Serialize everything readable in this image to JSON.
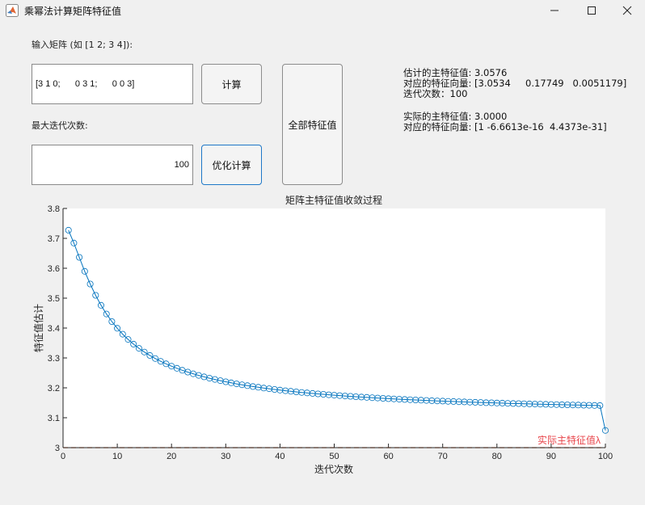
{
  "window": {
    "title": "乘幂法计算矩阵特征值",
    "icon": "matlab-icon"
  },
  "inputs": {
    "matrix_label": "输入矩阵 (如 [1 2; 3 4]):",
    "matrix_value": "[3 1 0;      0 3 1;      0 0 3]",
    "maxiter_label": "最大迭代次数:",
    "maxiter_value": "100"
  },
  "buttons": {
    "compute": "计算",
    "optimized": "优化计算",
    "all_eigen": "全部特征值"
  },
  "results": {
    "est_value": "估计的主特征值: 3.0576",
    "est_vector": "对应的特征向量: [3.0534     0.17749   0.0051179]",
    "iterations": "迭代次数：100",
    "true_value": "实际的主特征值: 3.0000",
    "true_vector": "对应的特征向量: [1 -6.6613e-16  4.4373e-31]"
  },
  "chart_data": {
    "type": "line",
    "title": "矩阵主特征值收敛过程",
    "xlabel": "迭代次数",
    "ylabel": "特征值估计",
    "xlim": [
      0,
      100
    ],
    "ylim": [
      3,
      3.8
    ],
    "xticks": [
      0,
      10,
      20,
      30,
      40,
      50,
      60,
      70,
      80,
      90,
      100
    ],
    "yticks": [
      3,
      3.1,
      3.2,
      3.3,
      3.4,
      3.5,
      3.6,
      3.7,
      3.8
    ],
    "grid": false,
    "series": [
      {
        "color": "#0072bd",
        "marker": "circle",
        "x": [
          1,
          2,
          3,
          4,
          5,
          6,
          7,
          8,
          9,
          10,
          11,
          12,
          13,
          14,
          15,
          16,
          17,
          18,
          19,
          20,
          21,
          22,
          23,
          24,
          25,
          26,
          27,
          28,
          29,
          30,
          31,
          32,
          33,
          34,
          35,
          36,
          37,
          38,
          39,
          40,
          41,
          42,
          43,
          44,
          45,
          46,
          47,
          48,
          49,
          50,
          51,
          52,
          53,
          54,
          55,
          56,
          57,
          58,
          59,
          60,
          61,
          62,
          63,
          64,
          65,
          66,
          67,
          68,
          69,
          70,
          71,
          72,
          73,
          74,
          75,
          76,
          77,
          78,
          79,
          80,
          81,
          82,
          83,
          84,
          85,
          86,
          87,
          88,
          89,
          90,
          91,
          92,
          93,
          94,
          95,
          96,
          97,
          98,
          99,
          100
        ],
        "y": [
          3.7273,
          3.6842,
          3.6364,
          3.5897,
          3.5472,
          3.5094,
          3.4762,
          3.4471,
          3.4216,
          3.3992,
          3.3794,
          3.3618,
          3.3462,
          3.3322,
          3.3196,
          3.3083,
          3.298,
          3.2887,
          3.2802,
          3.2724,
          3.2653,
          3.2587,
          3.2526,
          3.2469,
          3.2417,
          3.2368,
          3.2322,
          3.228,
          3.224,
          3.2202,
          3.2167,
          3.2133,
          3.2102,
          3.2072,
          3.2044,
          3.2018,
          3.1993,
          3.1969,
          3.1946,
          3.1924,
          3.1904,
          3.1884,
          3.1865,
          3.1847,
          3.183,
          3.1814,
          3.1798,
          3.1783,
          3.1768,
          3.1754,
          3.1741,
          3.1728,
          3.1715,
          3.1703,
          3.1691,
          3.168,
          3.1669,
          3.1659,
          3.1649,
          3.1639,
          3.1629,
          3.162,
          3.1611,
          3.1602,
          3.1594,
          3.1586,
          3.1578,
          3.157,
          3.1563,
          3.1556,
          3.1549,
          3.1542,
          3.1535,
          3.1529,
          3.1522,
          3.1516,
          3.151,
          3.1504,
          3.1499,
          3.1493,
          3.1488,
          3.1482,
          3.1477,
          3.1472,
          3.1467,
          3.1462,
          3.1458,
          3.1453,
          3.1449,
          3.1444,
          3.144,
          3.1436,
          3.1432,
          3.1428,
          3.1424,
          3.142,
          3.1416,
          3.1412,
          3.1409,
          3.0576
        ]
      },
      {
        "name": "实际主特征值",
        "color": "#d95319",
        "style": "dashed",
        "y_constant": 3.0
      }
    ],
    "annotation": "实际主特征值λ"
  }
}
